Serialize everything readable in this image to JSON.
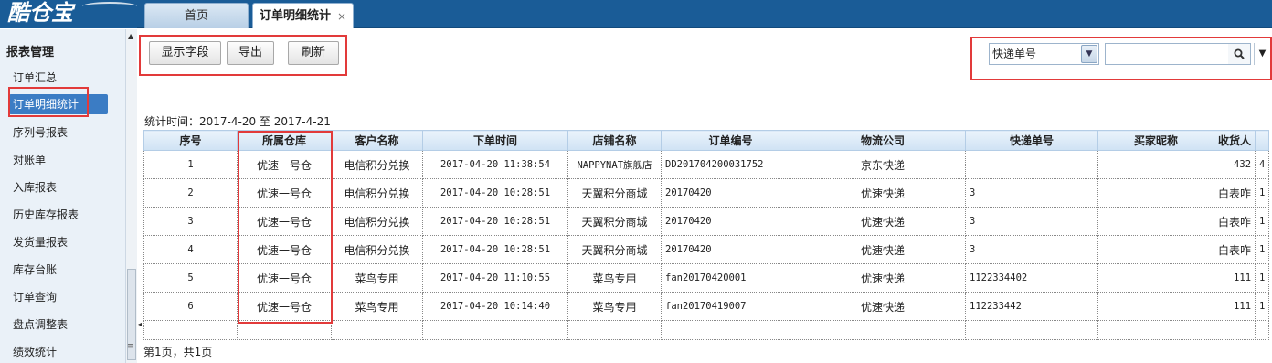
{
  "app": {
    "logo_text": "酷仓宝"
  },
  "tabs": [
    {
      "label": "首页"
    },
    {
      "label": "订单明细统计",
      "close": "×"
    }
  ],
  "sidebar": {
    "title": "报表管理",
    "items": [
      {
        "label": "订单汇总"
      },
      {
        "label": "订单明细统计"
      },
      {
        "label": "序列号报表"
      },
      {
        "label": "对账单"
      },
      {
        "label": "入库报表"
      },
      {
        "label": "历史库存报表"
      },
      {
        "label": "发货量报表"
      },
      {
        "label": "库存台账"
      },
      {
        "label": "订单查询"
      },
      {
        "label": "盘点调整表"
      },
      {
        "label": "绩效统计"
      }
    ]
  },
  "toolbar": {
    "show_fields_label": "显示字段",
    "export_label": "导出",
    "refresh_label": "刷新"
  },
  "search": {
    "field_selected": "快递单号",
    "input_value": ""
  },
  "stats": {
    "time_range": "统计时间：2017-4-20 至 2017-4-21"
  },
  "table": {
    "columns": [
      "序号",
      "所属仓库",
      "客户名称",
      "下单时间",
      "店铺名称",
      "订单编号",
      "物流公司",
      "快递单号",
      "买家昵称",
      "收货人"
    ],
    "rows": [
      [
        "1",
        "优速一号仓",
        "电信积分兑换",
        "2017-04-20  11:38:54",
        "NAPPYNAT旗舰店",
        "DD201704200031752",
        "京东快递",
        "",
        "",
        "432"
      ],
      [
        "2",
        "优速一号仓",
        "电信积分兑换",
        "2017-04-20  10:28:51",
        "天翼积分商城",
        "20170420",
        "优速快递",
        "3",
        "",
        "白表咋"
      ],
      [
        "3",
        "优速一号仓",
        "电信积分兑换",
        "2017-04-20  10:28:51",
        "天翼积分商城",
        "20170420",
        "优速快递",
        "3",
        "",
        "白表咋"
      ],
      [
        "4",
        "优速一号仓",
        "电信积分兑换",
        "2017-04-20  10:28:51",
        "天翼积分商城",
        "20170420",
        "优速快递",
        "3",
        "",
        "白表咋"
      ],
      [
        "5",
        "优速一号仓",
        "菜鸟专用",
        "2017-04-20  11:10:55",
        "菜鸟专用",
        "fan20170420001",
        "优速快递",
        "1122334402",
        "",
        "111"
      ],
      [
        "6",
        "优速一号仓",
        "菜鸟专用",
        "2017-04-20  10:14:40",
        "菜鸟专用",
        "fan20170419007",
        "优速快递",
        "112233442",
        "",
        "111"
      ]
    ],
    "overflow_column_cells": [
      "4",
      "1",
      "1",
      "1",
      "1",
      "1"
    ]
  },
  "pager": {
    "text": "第1页，共1页"
  },
  "colors": {
    "accent": "#3b7cc4",
    "highlight_box": "#e23a3a",
    "topbar": "#1a5c97"
  }
}
